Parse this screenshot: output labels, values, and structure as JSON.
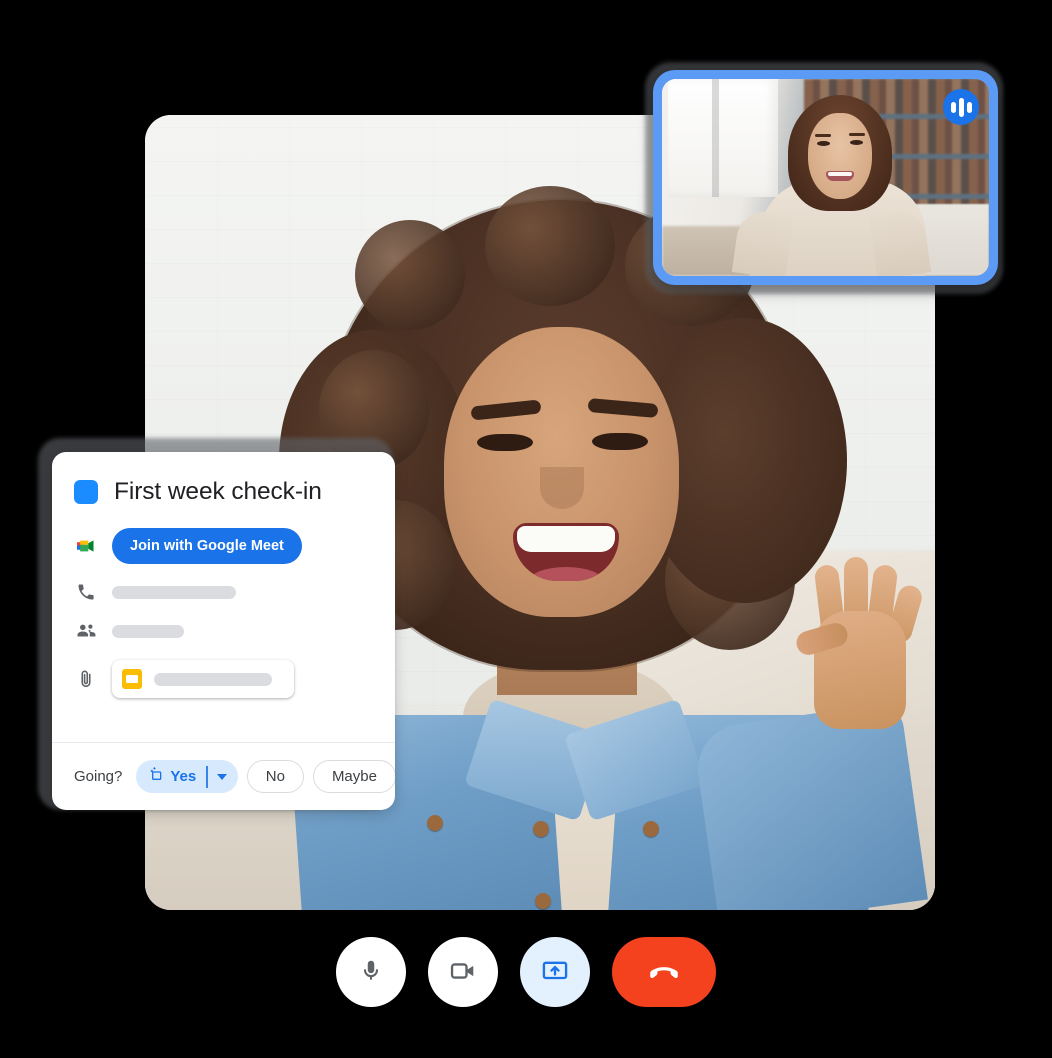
{
  "app": {
    "name": "Google Meet video call"
  },
  "main_video": {
    "participant": "smiling woman with curly hair waving",
    "background": "white brick wall living room"
  },
  "pip": {
    "participant": "woman in beige top in front of bookshelf",
    "audio_badge_icon": "audio-waveform-icon",
    "border_color": "#5b9bf5"
  },
  "event_card": {
    "color_chip": "#1a8cff",
    "title": "First week check-in",
    "join_button": {
      "label": "Join with Google Meet",
      "icon": "google-meet-icon",
      "background": "#1a73e8"
    },
    "rows": [
      {
        "icon": "phone-icon",
        "value": ""
      },
      {
        "icon": "people-icon",
        "value": ""
      },
      {
        "icon": "attachment-icon",
        "value": "",
        "file_icon": "slides-file-icon",
        "file_icon_color": "#fbbc04"
      }
    ],
    "footer": {
      "going_label": "Going?",
      "yes": {
        "label": "Yes",
        "icon": "rsvp-yes-icon",
        "selected": true,
        "accent": "#1a73e8",
        "background": "#d6e9fd"
      },
      "no": {
        "label": "No"
      },
      "maybe": {
        "label": "Maybe"
      },
      "dropdown_icon": "caret-down-icon"
    }
  },
  "controls": [
    {
      "name": "microphone",
      "icon": "microphone-icon",
      "label": "Turn off microphone",
      "background": "#ffffff"
    },
    {
      "name": "camera",
      "icon": "video-camera-icon",
      "label": "Turn off camera",
      "background": "#ffffff"
    },
    {
      "name": "present",
      "icon": "present-screen-icon",
      "label": "Present now",
      "background": "#e3f0fd",
      "accent": "#1a73e8"
    },
    {
      "name": "hangup",
      "icon": "hangup-phone-icon",
      "label": "Leave call",
      "background": "#f4411e"
    }
  ],
  "colors": {
    "google_blue": "#1a73e8",
    "google_red": "#f4411e",
    "google_yellow": "#fbbc04",
    "google_green": "#34a853",
    "pip_border": "#5b9bf5",
    "page_background": "#000000"
  }
}
